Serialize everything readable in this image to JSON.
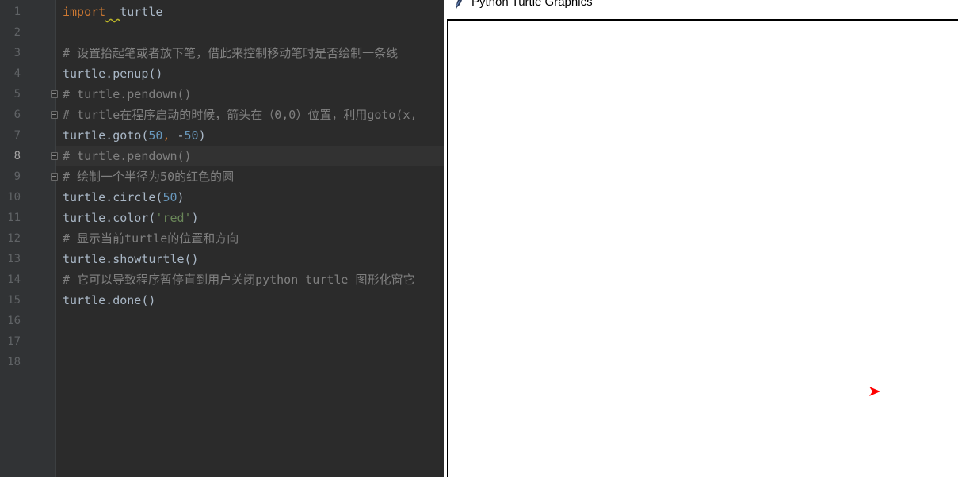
{
  "editor": {
    "line_numbers": [
      "1",
      "2",
      "3",
      "4",
      "5",
      "6",
      "7",
      "8",
      "9",
      "10",
      "11",
      "12",
      "13",
      "14",
      "15",
      "16",
      "17",
      "18"
    ],
    "current_line": 8,
    "lines": [
      [
        {
          "t": "import",
          "c": "kw"
        },
        {
          "t": "  ",
          "c": "squiggle"
        },
        {
          "t": "turtle",
          "c": "ident"
        }
      ],
      [],
      [
        {
          "t": "# 设置抬起笔或者放下笔，借此来控制移动笔时是否绘制一条线",
          "c": "cmt"
        }
      ],
      [
        {
          "t": "turtle.penup()",
          "c": "ident"
        }
      ],
      [
        {
          "t": "# turtle.pendown()",
          "c": "cmt"
        }
      ],
      [
        {
          "t": "# turtle在程序启动的时候，箭头在（0,0）位置，利用goto(x,",
          "c": "cmt"
        }
      ],
      [
        {
          "t": "turtle.goto(",
          "c": "ident"
        },
        {
          "t": "50",
          "c": "num"
        },
        {
          "t": ", ",
          "c": "kw"
        },
        {
          "t": "-",
          "c": "ident"
        },
        {
          "t": "50",
          "c": "num"
        },
        {
          "t": ")",
          "c": "ident"
        }
      ],
      [
        {
          "t": "# turtle.pendown()",
          "c": "cmt"
        }
      ],
      [
        {
          "t": "# 绘制一个半径为50的红色的圆",
          "c": "cmt"
        }
      ],
      [
        {
          "t": "turtle.circle(",
          "c": "ident"
        },
        {
          "t": "50",
          "c": "num"
        },
        {
          "t": ")",
          "c": "ident"
        }
      ],
      [
        {
          "t": "turtle.color(",
          "c": "ident"
        },
        {
          "t": "'red'",
          "c": "str"
        },
        {
          "t": ")",
          "c": "ident"
        }
      ],
      [
        {
          "t": "# 显示当前turtle的位置和方向",
          "c": "cmt"
        }
      ],
      [
        {
          "t": "turtle.showturtle()",
          "c": "ident"
        }
      ],
      [
        {
          "t": "# 它可以导致程序暂停直到用户关闭python turtle 图形化窗它",
          "c": "cmt"
        }
      ],
      [
        {
          "t": "turtle.done()",
          "c": "ident"
        }
      ],
      [],
      [],
      []
    ],
    "fold_markers_on_lines": [
      5,
      6,
      8,
      9
    ]
  },
  "turtle_window": {
    "title": "Python Turtle Graphics",
    "icon": "feather-icon",
    "turtle_color": "#ff0000",
    "turtle_icon": "arrow-cursor-icon"
  },
  "colors": {
    "editor_bg": "#2b2b2b",
    "gutter_bg": "#313335",
    "keyword": "#cc7832",
    "number": "#6897bb",
    "string": "#6a8759",
    "comment": "#808080",
    "text": "#a9b7c6"
  }
}
